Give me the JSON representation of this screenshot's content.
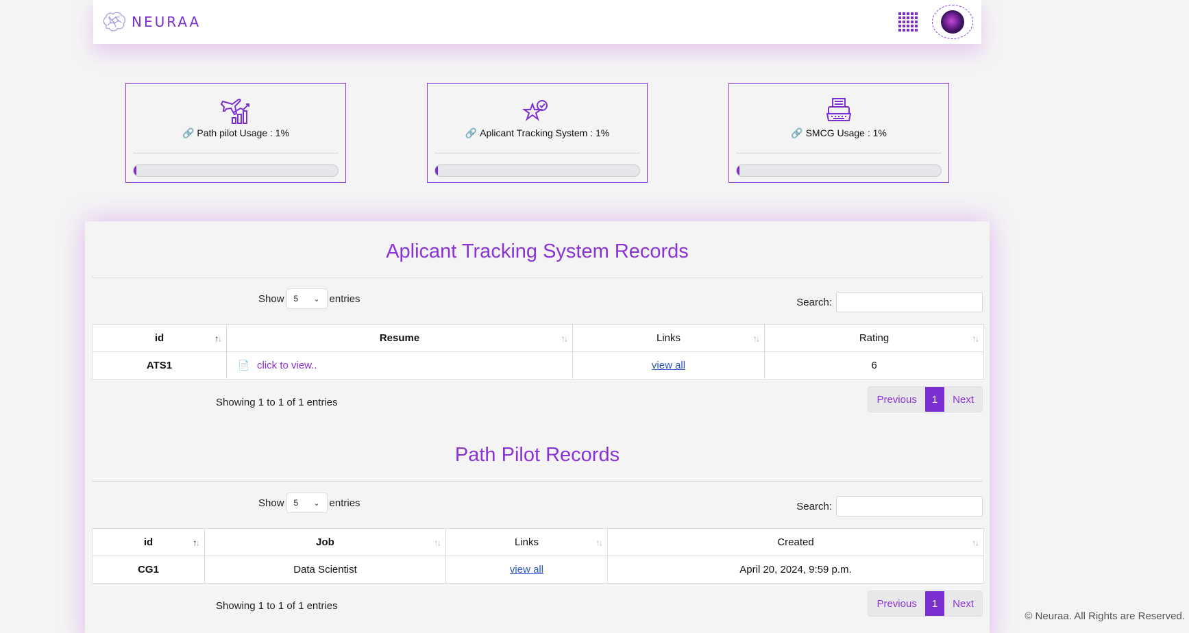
{
  "brand": {
    "name": "NEURAA",
    "accent": "#7b2fd1"
  },
  "header": {
    "apps_icon": "grid-icon",
    "avatar_icon": "user-avatar"
  },
  "usage_cards": [
    {
      "label": "Path pilot Usage : 1%",
      "icon": "airplane-chart-icon",
      "progress": 0.01
    },
    {
      "label": "Aplicant Tracking System : 1%",
      "icon": "star-check-icon",
      "progress": 0.01
    },
    {
      "label": "SMCG Usage : 1%",
      "icon": "typewriter-icon",
      "progress": 0.01
    }
  ],
  "ats": {
    "title": "Aplicant Tracking System Records",
    "show_label": "Show",
    "entries_label": "entries",
    "page_size": "5",
    "search_label": "Search:",
    "search_value": "",
    "columns": [
      "id",
      "Resume",
      "Links",
      "Rating"
    ],
    "rows": [
      {
        "id": "ATS1",
        "resume": "click to view..",
        "links": "view all",
        "rating": "6"
      }
    ],
    "showing": "Showing 1 to 1 of 1 entries",
    "pager": {
      "prev": "Previous",
      "current": "1",
      "next": "Next"
    }
  },
  "pathpilot": {
    "title": "Path Pilot Records",
    "show_label": "Show",
    "entries_label": "entries",
    "page_size": "5",
    "search_label": "Search:",
    "search_value": "",
    "columns": [
      "id",
      "Job",
      "Links",
      "Created"
    ],
    "rows": [
      {
        "id": "CG1",
        "job": "Data Scientist",
        "links": "view all",
        "created": "April 20, 2024, 9:59 p.m."
      }
    ],
    "showing": "Showing 1 to 1 of 1 entries",
    "pager": {
      "prev": "Previous",
      "current": "1",
      "next": "Next"
    }
  },
  "footer": {
    "text": "© Neuraa. All Rights are Reserved."
  }
}
